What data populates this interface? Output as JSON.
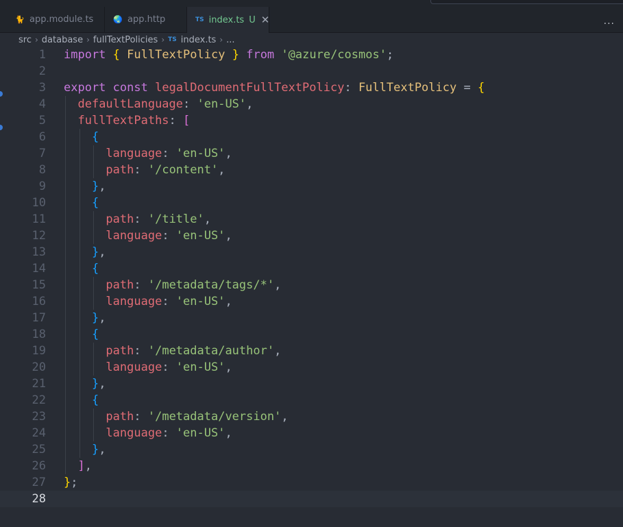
{
  "tabs": [
    {
      "label": "app.module.ts",
      "icon": "nest-icon"
    },
    {
      "label": "app.http",
      "icon": "globe-icon"
    },
    {
      "label": "index.ts",
      "icon": "ts-icon",
      "badge": "U",
      "close": "✕"
    }
  ],
  "tab_actions": {
    "more": "···"
  },
  "breadcrumb": {
    "items": [
      "src",
      "database",
      "fullTextPolicies",
      "index.ts",
      "..."
    ],
    "ts_icon": "TS"
  },
  "editor": {
    "current_line": 28,
    "lines": [
      [
        [
          "kw",
          "import"
        ],
        [
          "pu",
          " "
        ],
        [
          "p1",
          "{"
        ],
        [
          "pu",
          " "
        ],
        [
          "ty",
          "FullTextPolicy"
        ],
        [
          "pu",
          " "
        ],
        [
          "p1",
          "}"
        ],
        [
          "pu",
          " "
        ],
        [
          "kw",
          "from"
        ],
        [
          "pu",
          " "
        ],
        [
          "st",
          "'@azure/cosmos'"
        ],
        [
          "pu",
          ";"
        ]
      ],
      [],
      [
        [
          "kw",
          "export"
        ],
        [
          "pu",
          " "
        ],
        [
          "kw",
          "const"
        ],
        [
          "pu",
          " "
        ],
        [
          "vr",
          "legalDocumentFullTextPolicy"
        ],
        [
          "pu",
          ": "
        ],
        [
          "ty",
          "FullTextPolicy"
        ],
        [
          "pu",
          " = "
        ],
        [
          "p1",
          "{"
        ]
      ],
      [
        [
          "pu",
          "  "
        ],
        [
          "pr",
          "defaultLanguage"
        ],
        [
          "pu",
          ": "
        ],
        [
          "st",
          "'en-US'"
        ],
        [
          "pu",
          ","
        ]
      ],
      [
        [
          "pu",
          "  "
        ],
        [
          "pr",
          "fullTextPaths"
        ],
        [
          "pu",
          ": "
        ],
        [
          "p2",
          "["
        ]
      ],
      [
        [
          "pu",
          "    "
        ],
        [
          "p3",
          "{"
        ]
      ],
      [
        [
          "pu",
          "      "
        ],
        [
          "pr",
          "language"
        ],
        [
          "pu",
          ": "
        ],
        [
          "st",
          "'en-US'"
        ],
        [
          "pu",
          ","
        ]
      ],
      [
        [
          "pu",
          "      "
        ],
        [
          "pr",
          "path"
        ],
        [
          "pu",
          ": "
        ],
        [
          "st",
          "'/content'"
        ],
        [
          "pu",
          ","
        ]
      ],
      [
        [
          "pu",
          "    "
        ],
        [
          "p3",
          "}"
        ],
        [
          "pu",
          ","
        ]
      ],
      [
        [
          "pu",
          "    "
        ],
        [
          "p3",
          "{"
        ]
      ],
      [
        [
          "pu",
          "      "
        ],
        [
          "pr",
          "path"
        ],
        [
          "pu",
          ": "
        ],
        [
          "st",
          "'/title'"
        ],
        [
          "pu",
          ","
        ]
      ],
      [
        [
          "pu",
          "      "
        ],
        [
          "pr",
          "language"
        ],
        [
          "pu",
          ": "
        ],
        [
          "st",
          "'en-US'"
        ],
        [
          "pu",
          ","
        ]
      ],
      [
        [
          "pu",
          "    "
        ],
        [
          "p3",
          "}"
        ],
        [
          "pu",
          ","
        ]
      ],
      [
        [
          "pu",
          "    "
        ],
        [
          "p3",
          "{"
        ]
      ],
      [
        [
          "pu",
          "      "
        ],
        [
          "pr",
          "path"
        ],
        [
          "pu",
          ": "
        ],
        [
          "st",
          "'/metadata/tags/*'"
        ],
        [
          "pu",
          ","
        ]
      ],
      [
        [
          "pu",
          "      "
        ],
        [
          "pr",
          "language"
        ],
        [
          "pu",
          ": "
        ],
        [
          "st",
          "'en-US'"
        ],
        [
          "pu",
          ","
        ]
      ],
      [
        [
          "pu",
          "    "
        ],
        [
          "p3",
          "}"
        ],
        [
          "pu",
          ","
        ]
      ],
      [
        [
          "pu",
          "    "
        ],
        [
          "p3",
          "{"
        ]
      ],
      [
        [
          "pu",
          "      "
        ],
        [
          "pr",
          "path"
        ],
        [
          "pu",
          ": "
        ],
        [
          "st",
          "'/metadata/author'"
        ],
        [
          "pu",
          ","
        ]
      ],
      [
        [
          "pu",
          "      "
        ],
        [
          "pr",
          "language"
        ],
        [
          "pu",
          ": "
        ],
        [
          "st",
          "'en-US'"
        ],
        [
          "pu",
          ","
        ]
      ],
      [
        [
          "pu",
          "    "
        ],
        [
          "p3",
          "}"
        ],
        [
          "pu",
          ","
        ]
      ],
      [
        [
          "pu",
          "    "
        ],
        [
          "p3",
          "{"
        ]
      ],
      [
        [
          "pu",
          "      "
        ],
        [
          "pr",
          "path"
        ],
        [
          "pu",
          ": "
        ],
        [
          "st",
          "'/metadata/version'"
        ],
        [
          "pu",
          ","
        ]
      ],
      [
        [
          "pu",
          "      "
        ],
        [
          "pr",
          "language"
        ],
        [
          "pu",
          ": "
        ],
        [
          "st",
          "'en-US'"
        ],
        [
          "pu",
          ","
        ]
      ],
      [
        [
          "pu",
          "    "
        ],
        [
          "p3",
          "}"
        ],
        [
          "pu",
          ","
        ]
      ],
      [
        [
          "pu",
          "  "
        ],
        [
          "p2",
          "]"
        ],
        [
          "pu",
          ","
        ]
      ],
      [
        [
          "p1",
          "}"
        ],
        [
          "pu",
          ";"
        ]
      ],
      []
    ]
  }
}
